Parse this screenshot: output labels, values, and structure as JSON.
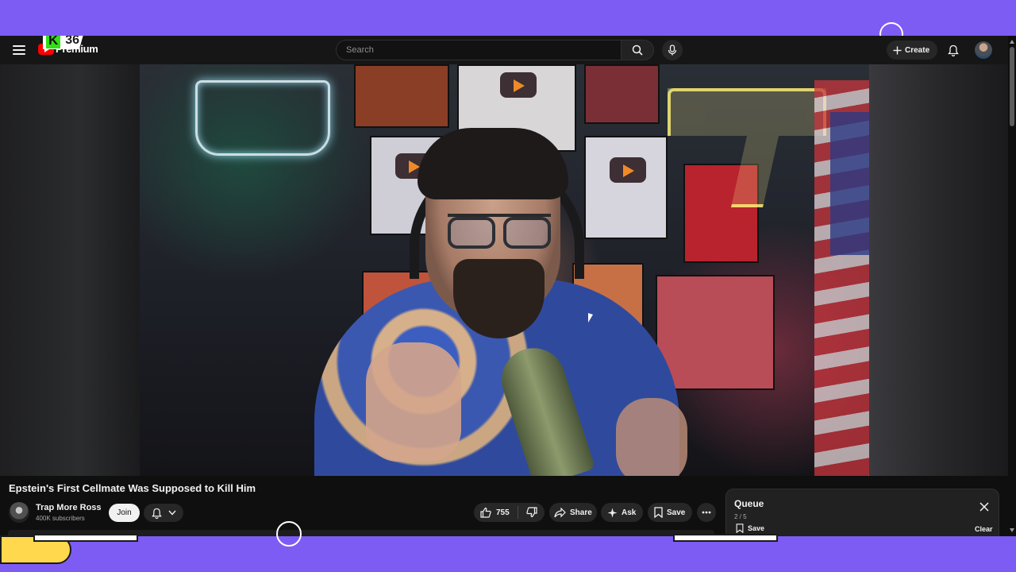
{
  "overlay": {
    "badge_letter": "K",
    "badge_number": "36"
  },
  "masthead": {
    "logo_text": "Premium",
    "search_placeholder": "Search",
    "create_label": "Create",
    "icons": {
      "menu": "hamburger-icon",
      "search": "search-icon",
      "mic": "microphone-icon",
      "create": "plus-icon",
      "notifications": "bell-icon"
    }
  },
  "video": {
    "title": "Epstein's First Cellmate Was Supposed to Kill Him"
  },
  "channel": {
    "name": "Trap More Ross",
    "subscribers": "400K subscribers",
    "join_label": "Join"
  },
  "actions": {
    "like_count": "755",
    "share_label": "Share",
    "ask_label": "Ask",
    "save_label": "Save"
  },
  "queue": {
    "title": "Queue",
    "position": "2 / 5",
    "save_label": "Save",
    "clear_label": "Clear"
  },
  "colors": {
    "frame_background": "#7d5cf4",
    "page_background": "#0f0f0f",
    "button_background": "#272727",
    "brand_red": "#ff0000"
  }
}
